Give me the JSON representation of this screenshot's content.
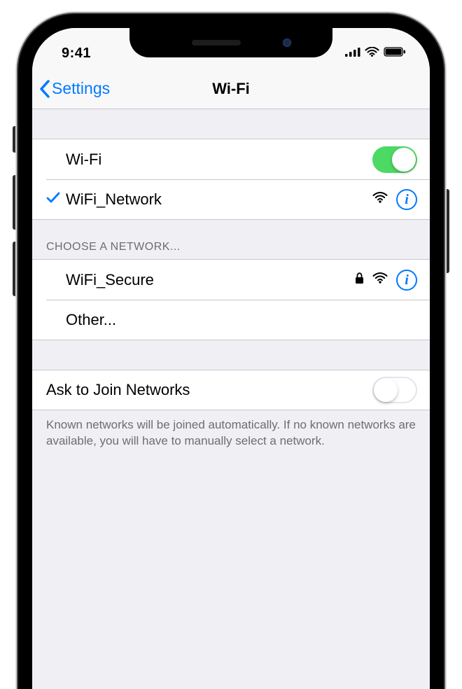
{
  "status_bar": {
    "time": "9:41"
  },
  "nav": {
    "back_label": "Settings",
    "title": "Wi-Fi"
  },
  "wifi_section": {
    "toggle_label": "Wi-Fi",
    "toggle_on": true,
    "connected": {
      "name": "WiFi_Network",
      "secured": false
    }
  },
  "choose_header": "CHOOSE A NETWORK...",
  "networks": [
    {
      "name": "WiFi_Secure",
      "secured": true
    }
  ],
  "other_label": "Other...",
  "ask_join": {
    "label": "Ask to Join Networks",
    "on": false,
    "footer": "Known networks will be joined automatically. If no known networks are available, you will have to manually select a network."
  }
}
